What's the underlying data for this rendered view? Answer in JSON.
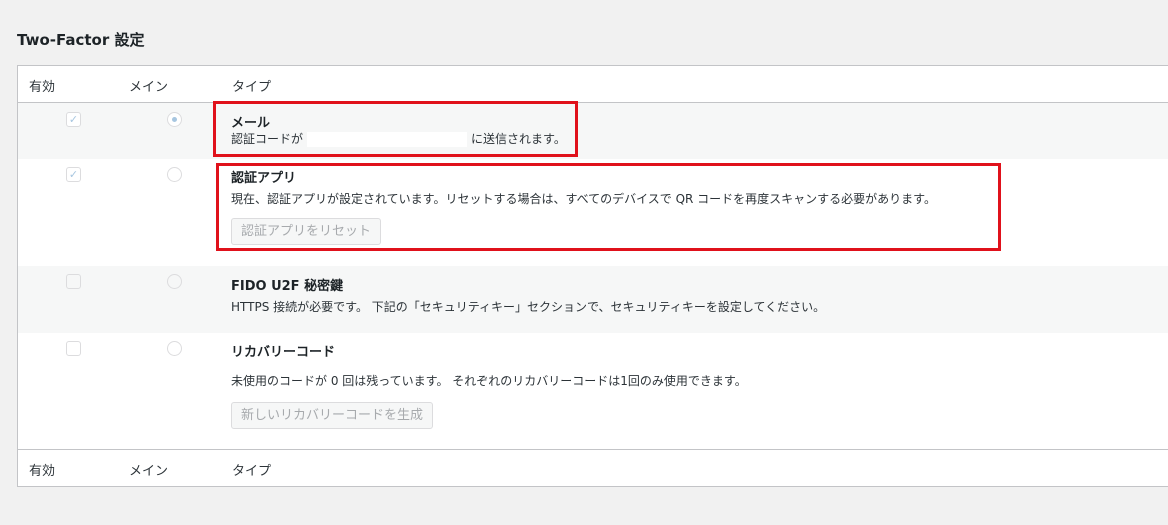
{
  "section_title": "Two-Factor 設定",
  "columns": {
    "enabled": "有効",
    "primary": "メイン",
    "type": "タイプ"
  },
  "providers": {
    "email": {
      "name": "メール",
      "desc_prefix": "認証コードが",
      "desc_suffix": "に送信されます。",
      "enabled": true,
      "primary": true
    },
    "totp": {
      "name": "認証アプリ",
      "desc": "現在、認証アプリが設定されています。リセットする場合は、すべてのデバイスで QR コードを再度スキャンする必要があります。",
      "button": "認証アプリをリセット",
      "enabled": true,
      "primary": false
    },
    "u2f": {
      "name": "FIDO U2F 秘密鍵",
      "desc": "HTTPS 接続が必要です。 下記の「セキュリティキー」セクションで、セキュリティキーを設定してください。",
      "enabled": false,
      "primary": false
    },
    "backup": {
      "name": "リカバリーコード",
      "desc": "未使用のコードが 0 回は残っています。 それぞれのリカバリーコードは1回のみ使用できます。",
      "button": "新しいリカバリーコードを生成",
      "enabled": false,
      "primary": false
    }
  },
  "checkmark_glyph": "✓",
  "highlight_color": "#e0111b"
}
